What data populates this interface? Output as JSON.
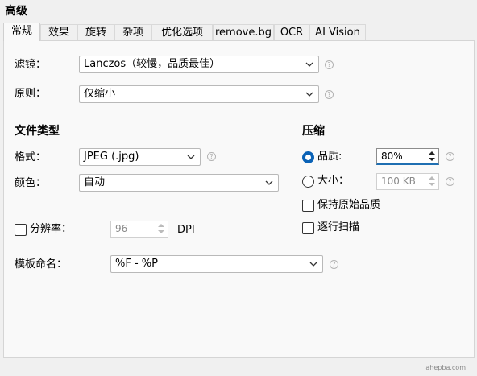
{
  "heading": "高级",
  "tabs": [
    {
      "label": "常规",
      "active": true
    },
    {
      "label": "效果"
    },
    {
      "label": "旋转"
    },
    {
      "label": "杂项"
    },
    {
      "label": "优化选项"
    },
    {
      "label": "remove.bg"
    },
    {
      "label": "OCR"
    },
    {
      "label": "AI Vision"
    }
  ],
  "filter": {
    "label": "滤镜：",
    "value": "Lanczos（较慢，品质最佳）"
  },
  "principle": {
    "label": "原则：",
    "value": "仅缩小"
  },
  "file_type": {
    "title": "文件类型",
    "format_label": "格式：",
    "format_value": "JPEG (.jpg)",
    "color_label": "颜色：",
    "color_value": "自动"
  },
  "compression": {
    "title": "压缩",
    "quality_label": "品质:",
    "quality_value": "80%",
    "quality_selected": true,
    "size_label": "大小：",
    "size_value": "100 KB",
    "keep_quality_label": "保持原始品质",
    "progressive_label": "逐行扫描"
  },
  "resolution": {
    "label": "分辨率：",
    "value": "96",
    "unit": "DPI",
    "checked": false
  },
  "template": {
    "label": "模板命名：",
    "value": "%F - %P"
  },
  "help_glyph": "?",
  "watermark": "ahepba.com",
  "icons": {
    "dropdown": "chevron-down-icon",
    "help": "help-circle-icon"
  }
}
